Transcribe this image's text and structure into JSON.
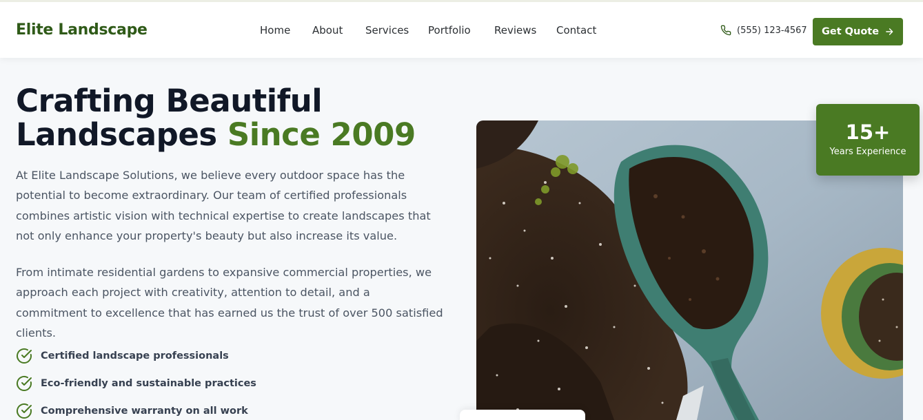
{
  "header": {
    "brand": "Elite Landscape",
    "nav": [
      {
        "label": "Home"
      },
      {
        "label": "About"
      },
      {
        "label": "Services"
      },
      {
        "label": "Portfolio"
      },
      {
        "label": "Reviews"
      },
      {
        "label": "Contact"
      }
    ],
    "phone": "(555) 123-4567",
    "cta_label": "Get Quote"
  },
  "hero": {
    "title_line1": "Crafting Beautiful",
    "title_line2_plain": "Landscapes",
    "title_line2_accent": "Since 2009",
    "paragraphs": [
      "At Elite Landscape Solutions, we believe every outdoor space has the potential to become extraordinary. Our team of certified professionals combines artistic vision with technical expertise to create landscapes that not only enhance your property's beauty but also increase its value.",
      "From intimate residential gardens to expansive commercial properties, we approach each project with creativity, attention to detail, and a commitment to excellence that has earned us the trust of over 500 satisfied clients."
    ],
    "features": [
      "Certified landscape professionals",
      "Eco-friendly and sustainable practices",
      "Comprehensive warranty on all work"
    ]
  },
  "badge": {
    "value": "15+",
    "label": "Years Experience"
  },
  "colors": {
    "brand": "#2f5a18",
    "accent": "#4a7a23",
    "text": "#4b5563"
  },
  "icons": {
    "phone": "phone-icon",
    "cta": "arrow-right-icon",
    "feature": "check-circle-icon"
  }
}
